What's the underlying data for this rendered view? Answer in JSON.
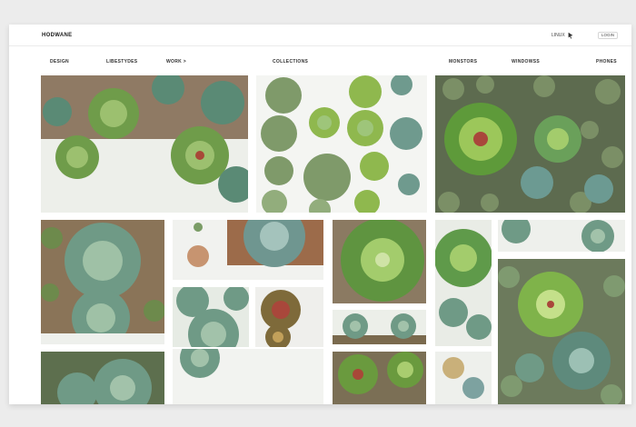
{
  "site": {
    "logo": "HODWANE"
  },
  "topbar": {
    "link_label": "LINUX",
    "button_label": "LOGIN"
  },
  "nav": {
    "items": [
      {
        "label": "DESIGN"
      },
      {
        "label": "LIBESTYDES"
      },
      {
        "label": "WORK >"
      },
      {
        "label": "COLLECTIONS"
      },
      {
        "label": "MONSTORS"
      },
      {
        "label": "WINDOWSS"
      },
      {
        "label": "PHONES"
      }
    ]
  },
  "gallery": {
    "theme": "succulents",
    "accent_colors": [
      "#5f8b3c",
      "#8fb36a",
      "#6f9a8e",
      "#a9473b",
      "#4f7a6d"
    ]
  }
}
